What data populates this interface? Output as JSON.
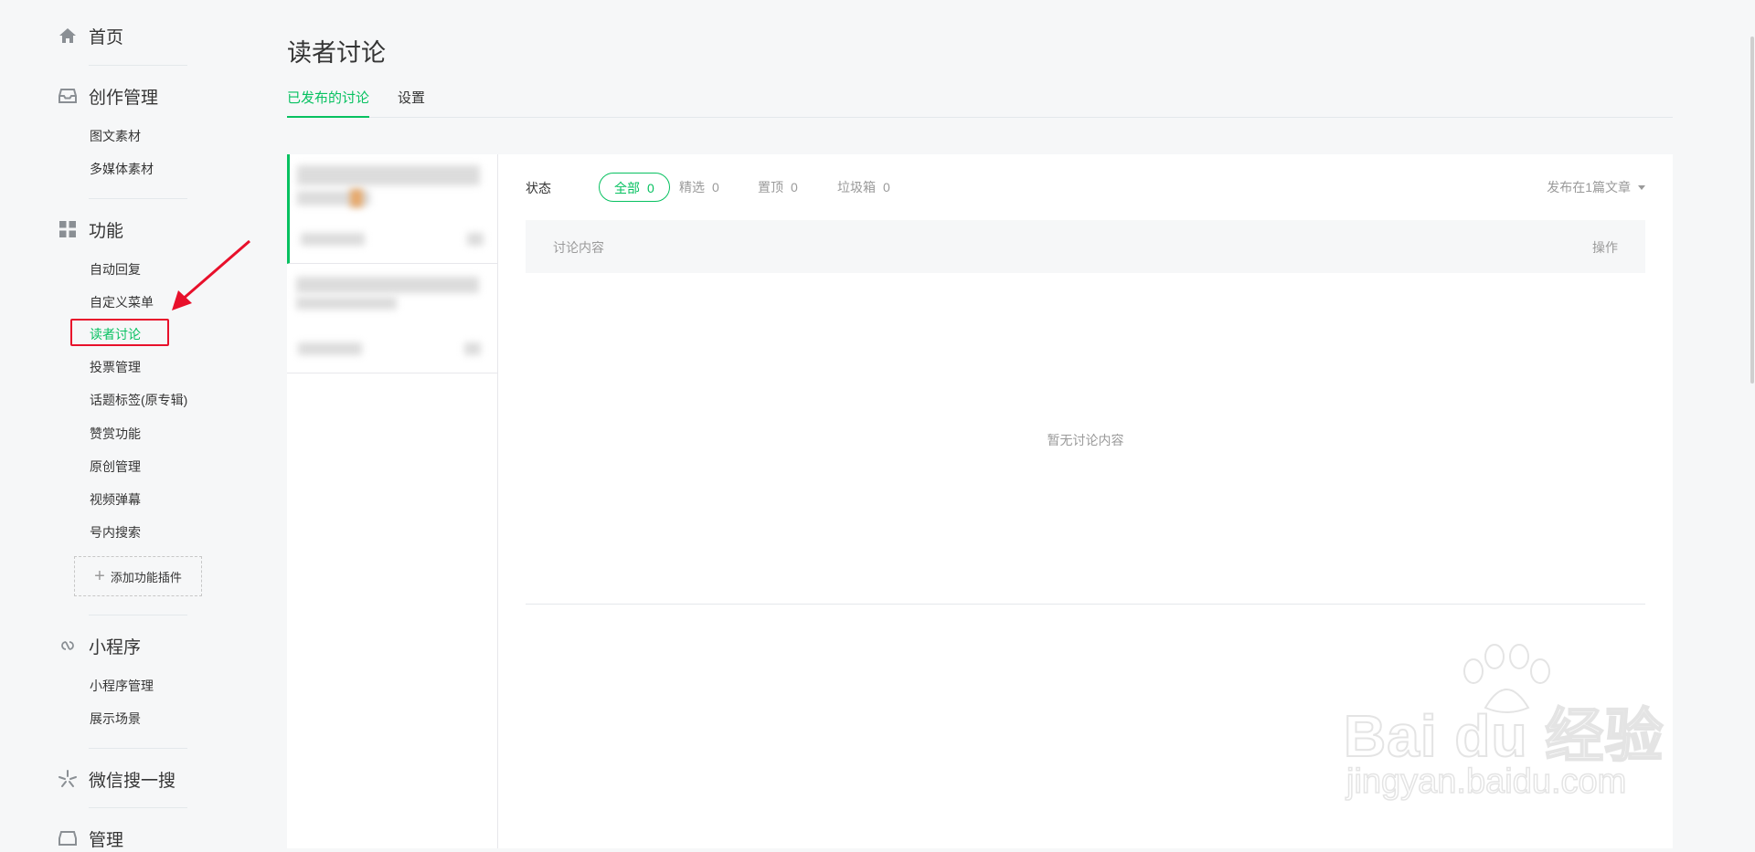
{
  "sidebar": {
    "home": {
      "label": "首页",
      "icon": "home-icon"
    },
    "creation": {
      "title": "创作管理",
      "icon": "inbox-icon",
      "items": [
        "图文素材",
        "多媒体素材"
      ]
    },
    "features": {
      "title": "功能",
      "icon": "grid-icon",
      "items": [
        "自动回复",
        "自定义菜单",
        "读者讨论",
        "投票管理",
        "话题标签(原专辑)",
        "赞赏功能",
        "原创管理",
        "视频弹幕",
        "号内搜索"
      ],
      "active_item": "读者讨论",
      "add_plugin_label": "添加功能插件"
    },
    "miniprogram": {
      "title": "小程序",
      "icon": "link-icon",
      "items": [
        "小程序管理",
        "展示场景"
      ]
    },
    "search": {
      "title": "微信搜一搜",
      "icon": "sparkle-icon"
    },
    "manage": {
      "title": "管理"
    }
  },
  "main": {
    "title": "读者讨论",
    "tabs": [
      {
        "label": "已发布的讨论",
        "active": true
      },
      {
        "label": "设置",
        "active": false
      }
    ],
    "filter": {
      "label": "状态",
      "options": [
        {
          "label": "全部",
          "count": "0",
          "active": true
        },
        {
          "label": "精选",
          "count": "0",
          "active": false
        },
        {
          "label": "置顶",
          "count": "0",
          "active": false
        },
        {
          "label": "垃圾箱",
          "count": "0",
          "active": false
        }
      ],
      "article_select": "发布在1篇文章"
    },
    "table": {
      "col_content": "讨论内容",
      "col_action": "操作",
      "empty_text": "暂无讨论内容"
    }
  },
  "watermark": {
    "brand": "Bai du 经验",
    "url": "jingyan.baidu.com"
  },
  "colors": {
    "accent": "#07c160",
    "highlight": "#e8102b",
    "text": "#353535",
    "muted": "#9a9a9a"
  }
}
